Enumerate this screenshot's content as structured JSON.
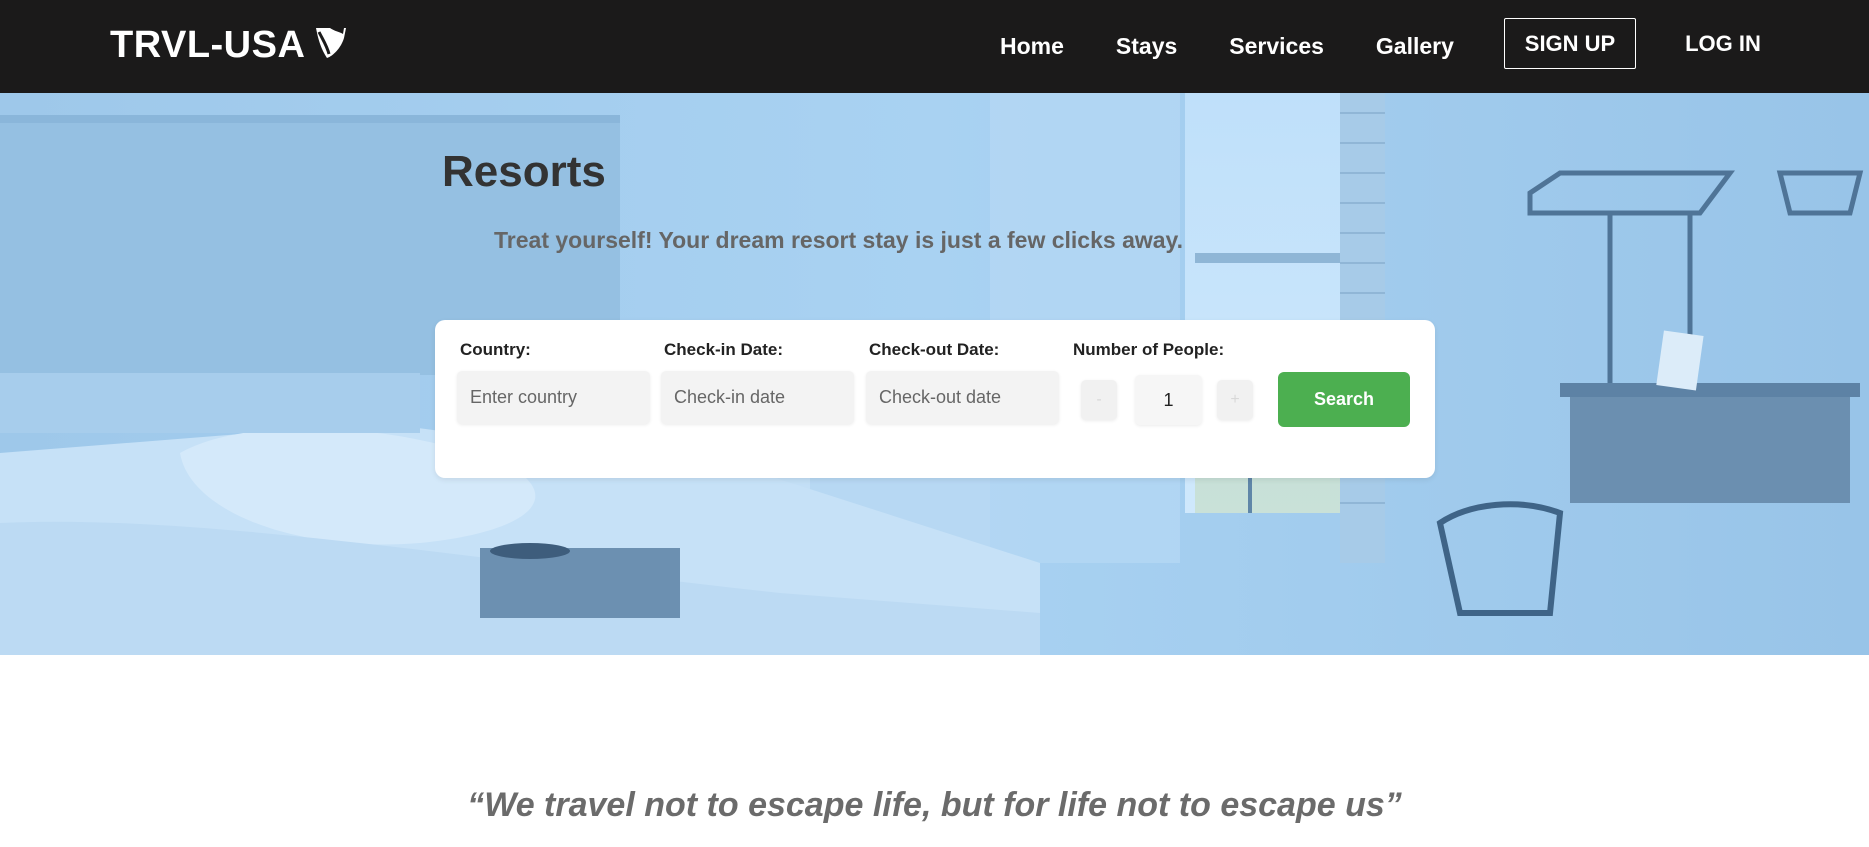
{
  "brand": {
    "name": "TRVL-USA",
    "logo_icon": "typo3-shield-icon"
  },
  "nav": {
    "links": [
      "Home",
      "Stays",
      "Services",
      "Gallery"
    ],
    "signup_label": "SIGN UP",
    "login_label": "LOG IN"
  },
  "hero": {
    "title": "Resorts",
    "subtitle": "Treat yourself! Your dream resort stay is just a few clicks away.",
    "overlay_color": "#a8d0f0"
  },
  "search": {
    "country_label": "Country:",
    "country_placeholder": "Enter country",
    "checkin_label": "Check-in Date:",
    "checkin_placeholder": "Check-in date",
    "checkout_label": "Check-out Date:",
    "checkout_placeholder": "Check-out date",
    "people_label": "Number of People:",
    "decrement_label": "-",
    "increment_label": "+",
    "people_value": "1",
    "search_label": "Search",
    "search_color": "#4caf50"
  },
  "quote": {
    "text": "“We travel not to escape life, but for life not to escape us”"
  },
  "colors": {
    "navbar_bg": "#1b1a1a",
    "title_text": "#333333",
    "subtitle_text": "#666666",
    "quote_text": "#6b6b6b"
  }
}
